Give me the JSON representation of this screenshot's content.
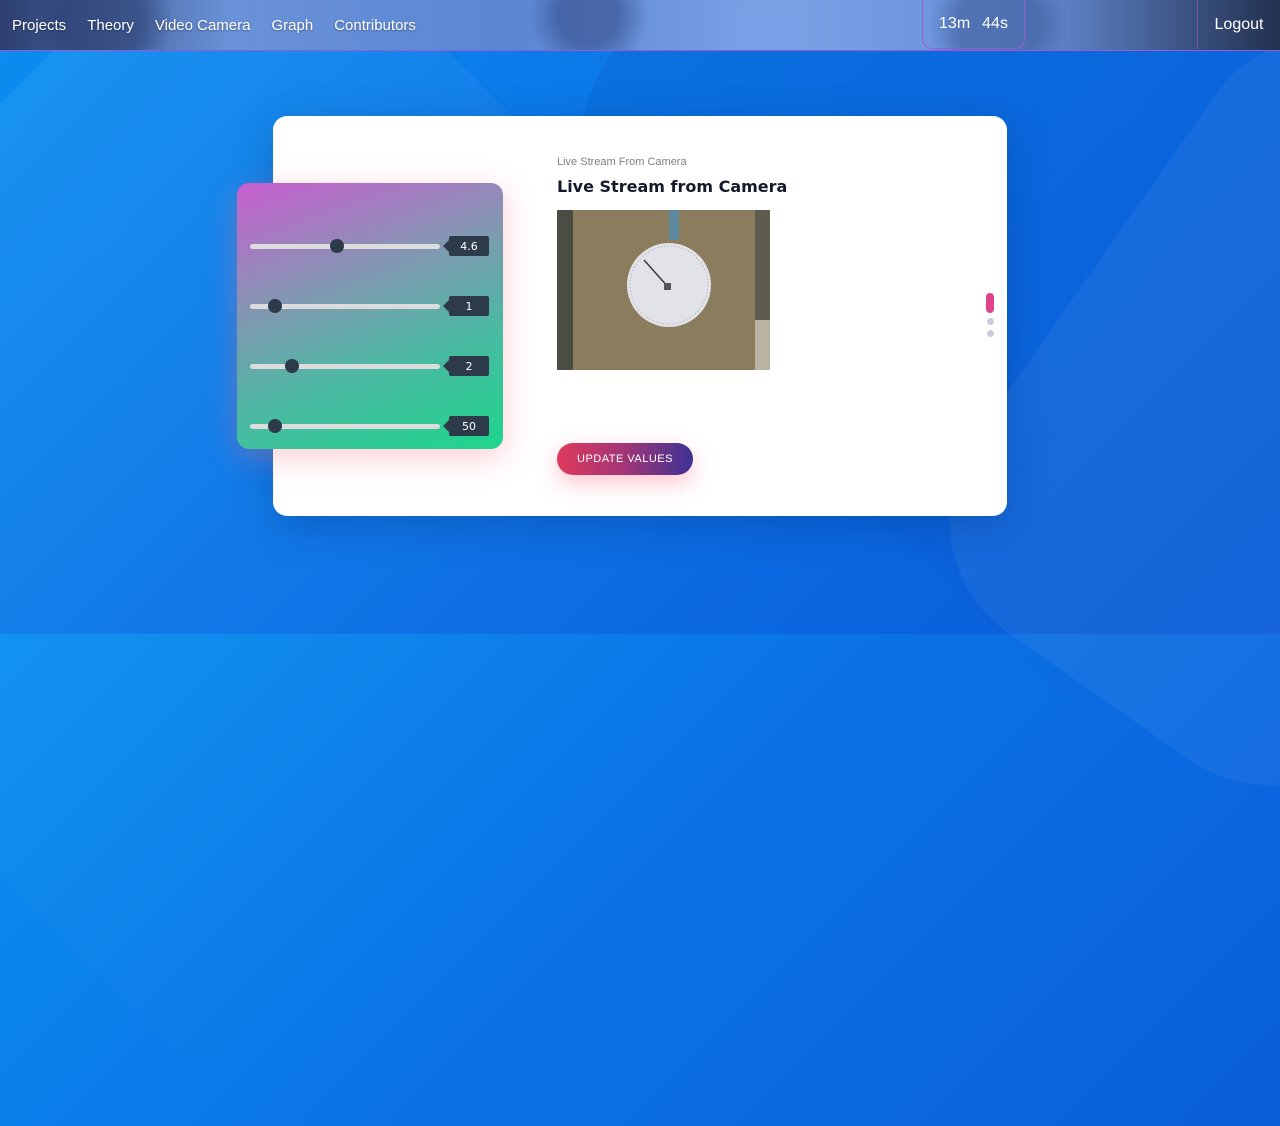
{
  "nav": {
    "links": [
      "Projects",
      "Theory",
      "Video Camera",
      "Graph",
      "Contributors"
    ],
    "timer_minutes": "13m",
    "timer_seconds": "44s",
    "logout": "Logout"
  },
  "sliders": [
    {
      "value": "4.6",
      "fraction": 0.46
    },
    {
      "value": "1",
      "fraction": 0.13
    },
    {
      "value": "2",
      "fraction": 0.22
    },
    {
      "value": "50",
      "fraction": 0.13
    }
  ],
  "card": {
    "subtitle": "Live Stream From Camera",
    "title": "Live Stream from Camera",
    "button": "UPDATE VALUES"
  },
  "pagination": {
    "count": 3,
    "active": 0
  },
  "colors": {
    "accent": "#e0418a",
    "slider_thumb": "#2d3a4a",
    "button_start": "#e03a5d",
    "button_end": "#3c3294"
  }
}
